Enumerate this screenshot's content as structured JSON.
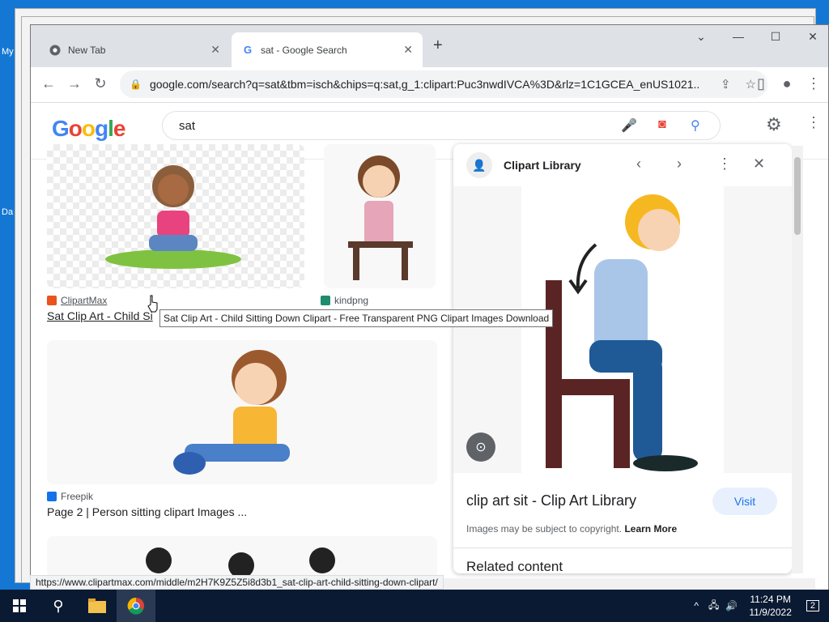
{
  "desktop": {
    "labels": [
      "My",
      "Da"
    ]
  },
  "browser": {
    "tabs": [
      {
        "label": "New Tab",
        "active": false
      },
      {
        "label": "sat - Google Search",
        "active": true
      }
    ],
    "url": "google.com/search?q=sat&tbm=isch&chips=q:sat,g_1:clipart:Puc3nwdIVCA%3D&rlz=1C1GCEA_enUS1021..."
  },
  "google": {
    "logo_letters": [
      "G",
      "o",
      "o",
      "g",
      "l",
      "e"
    ],
    "logo_colors": [
      "#4285f4",
      "#ea4335",
      "#fbbc05",
      "#4285f4",
      "#34a853",
      "#ea4335"
    ],
    "query": "sat"
  },
  "results": [
    {
      "source": "ClipartMax",
      "title": "Sat Clip Art - Child Si",
      "favicon_color": "#e8541c"
    },
    {
      "source": "kindpng",
      "favicon_color": "#1e8c6e"
    },
    {
      "source": "Freepik",
      "title": "Page 2 | Person sitting clipart Images ...",
      "favicon_color": "#1273eb"
    }
  ],
  "tooltip": "Sat Clip Art - Child Sitting Down Clipart - Free Transparent PNG Clipart  Images Download",
  "panel": {
    "site": "Clipart Library",
    "title": "clip art sit - Clip Art Library",
    "visit_label": "Visit",
    "copyright": "Images may be subject to copyright.",
    "learn_more": "Learn More",
    "related": "Related content"
  },
  "status_url": "https://www.clipartmax.com/middle/m2H7K9Z5Z5i8d3b1_sat-clip-art-child-sitting-down-clipart/",
  "taskbar": {
    "time": "11:24 PM",
    "date": "11/9/2022",
    "notifications": "2"
  }
}
